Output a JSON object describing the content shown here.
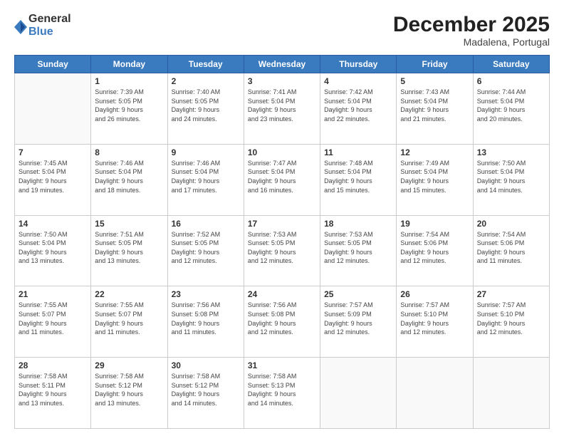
{
  "logo": {
    "general": "General",
    "blue": "Blue"
  },
  "header": {
    "month": "December 2025",
    "location": "Madalena, Portugal"
  },
  "days": [
    "Sunday",
    "Monday",
    "Tuesday",
    "Wednesday",
    "Thursday",
    "Friday",
    "Saturday"
  ],
  "weeks": [
    [
      {
        "day": "",
        "info": ""
      },
      {
        "day": "1",
        "info": "Sunrise: 7:39 AM\nSunset: 5:05 PM\nDaylight: 9 hours\nand 26 minutes."
      },
      {
        "day": "2",
        "info": "Sunrise: 7:40 AM\nSunset: 5:05 PM\nDaylight: 9 hours\nand 24 minutes."
      },
      {
        "day": "3",
        "info": "Sunrise: 7:41 AM\nSunset: 5:04 PM\nDaylight: 9 hours\nand 23 minutes."
      },
      {
        "day": "4",
        "info": "Sunrise: 7:42 AM\nSunset: 5:04 PM\nDaylight: 9 hours\nand 22 minutes."
      },
      {
        "day": "5",
        "info": "Sunrise: 7:43 AM\nSunset: 5:04 PM\nDaylight: 9 hours\nand 21 minutes."
      },
      {
        "day": "6",
        "info": "Sunrise: 7:44 AM\nSunset: 5:04 PM\nDaylight: 9 hours\nand 20 minutes."
      }
    ],
    [
      {
        "day": "7",
        "info": "Sunrise: 7:45 AM\nSunset: 5:04 PM\nDaylight: 9 hours\nand 19 minutes."
      },
      {
        "day": "8",
        "info": "Sunrise: 7:46 AM\nSunset: 5:04 PM\nDaylight: 9 hours\nand 18 minutes."
      },
      {
        "day": "9",
        "info": "Sunrise: 7:46 AM\nSunset: 5:04 PM\nDaylight: 9 hours\nand 17 minutes."
      },
      {
        "day": "10",
        "info": "Sunrise: 7:47 AM\nSunset: 5:04 PM\nDaylight: 9 hours\nand 16 minutes."
      },
      {
        "day": "11",
        "info": "Sunrise: 7:48 AM\nSunset: 5:04 PM\nDaylight: 9 hours\nand 15 minutes."
      },
      {
        "day": "12",
        "info": "Sunrise: 7:49 AM\nSunset: 5:04 PM\nDaylight: 9 hours\nand 15 minutes."
      },
      {
        "day": "13",
        "info": "Sunrise: 7:50 AM\nSunset: 5:04 PM\nDaylight: 9 hours\nand 14 minutes."
      }
    ],
    [
      {
        "day": "14",
        "info": "Sunrise: 7:50 AM\nSunset: 5:04 PM\nDaylight: 9 hours\nand 13 minutes."
      },
      {
        "day": "15",
        "info": "Sunrise: 7:51 AM\nSunset: 5:05 PM\nDaylight: 9 hours\nand 13 minutes."
      },
      {
        "day": "16",
        "info": "Sunrise: 7:52 AM\nSunset: 5:05 PM\nDaylight: 9 hours\nand 12 minutes."
      },
      {
        "day": "17",
        "info": "Sunrise: 7:53 AM\nSunset: 5:05 PM\nDaylight: 9 hours\nand 12 minutes."
      },
      {
        "day": "18",
        "info": "Sunrise: 7:53 AM\nSunset: 5:05 PM\nDaylight: 9 hours\nand 12 minutes."
      },
      {
        "day": "19",
        "info": "Sunrise: 7:54 AM\nSunset: 5:06 PM\nDaylight: 9 hours\nand 12 minutes."
      },
      {
        "day": "20",
        "info": "Sunrise: 7:54 AM\nSunset: 5:06 PM\nDaylight: 9 hours\nand 11 minutes."
      }
    ],
    [
      {
        "day": "21",
        "info": "Sunrise: 7:55 AM\nSunset: 5:07 PM\nDaylight: 9 hours\nand 11 minutes."
      },
      {
        "day": "22",
        "info": "Sunrise: 7:55 AM\nSunset: 5:07 PM\nDaylight: 9 hours\nand 11 minutes."
      },
      {
        "day": "23",
        "info": "Sunrise: 7:56 AM\nSunset: 5:08 PM\nDaylight: 9 hours\nand 11 minutes."
      },
      {
        "day": "24",
        "info": "Sunrise: 7:56 AM\nSunset: 5:08 PM\nDaylight: 9 hours\nand 12 minutes."
      },
      {
        "day": "25",
        "info": "Sunrise: 7:57 AM\nSunset: 5:09 PM\nDaylight: 9 hours\nand 12 minutes."
      },
      {
        "day": "26",
        "info": "Sunrise: 7:57 AM\nSunset: 5:10 PM\nDaylight: 9 hours\nand 12 minutes."
      },
      {
        "day": "27",
        "info": "Sunrise: 7:57 AM\nSunset: 5:10 PM\nDaylight: 9 hours\nand 12 minutes."
      }
    ],
    [
      {
        "day": "28",
        "info": "Sunrise: 7:58 AM\nSunset: 5:11 PM\nDaylight: 9 hours\nand 13 minutes."
      },
      {
        "day": "29",
        "info": "Sunrise: 7:58 AM\nSunset: 5:12 PM\nDaylight: 9 hours\nand 13 minutes."
      },
      {
        "day": "30",
        "info": "Sunrise: 7:58 AM\nSunset: 5:12 PM\nDaylight: 9 hours\nand 14 minutes."
      },
      {
        "day": "31",
        "info": "Sunrise: 7:58 AM\nSunset: 5:13 PM\nDaylight: 9 hours\nand 14 minutes."
      },
      {
        "day": "",
        "info": ""
      },
      {
        "day": "",
        "info": ""
      },
      {
        "day": "",
        "info": ""
      }
    ]
  ]
}
